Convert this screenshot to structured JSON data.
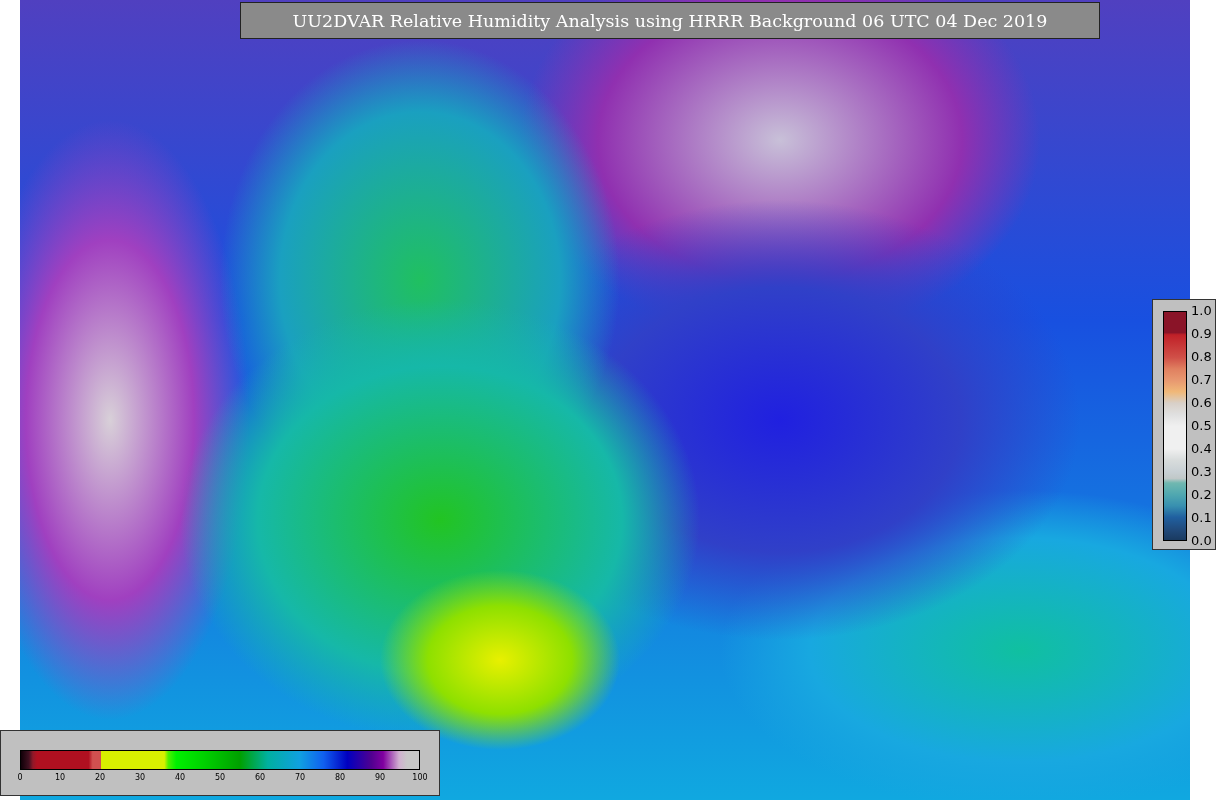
{
  "title": "UU2DVAR Relative Humidity Analysis using HRRR Background 06 UTC 04 Dec 2019",
  "humidity_legend": {
    "ticks": [
      "0",
      "10",
      "20",
      "30",
      "40",
      "50",
      "60",
      "70",
      "80",
      "90",
      "100"
    ]
  },
  "ratio_legend": {
    "ticks": [
      "1.0",
      "0.9",
      "0.8",
      "0.7",
      "0.6",
      "0.5",
      "0.4",
      "0.3",
      "0.2",
      "0.1",
      "0.0"
    ]
  }
}
